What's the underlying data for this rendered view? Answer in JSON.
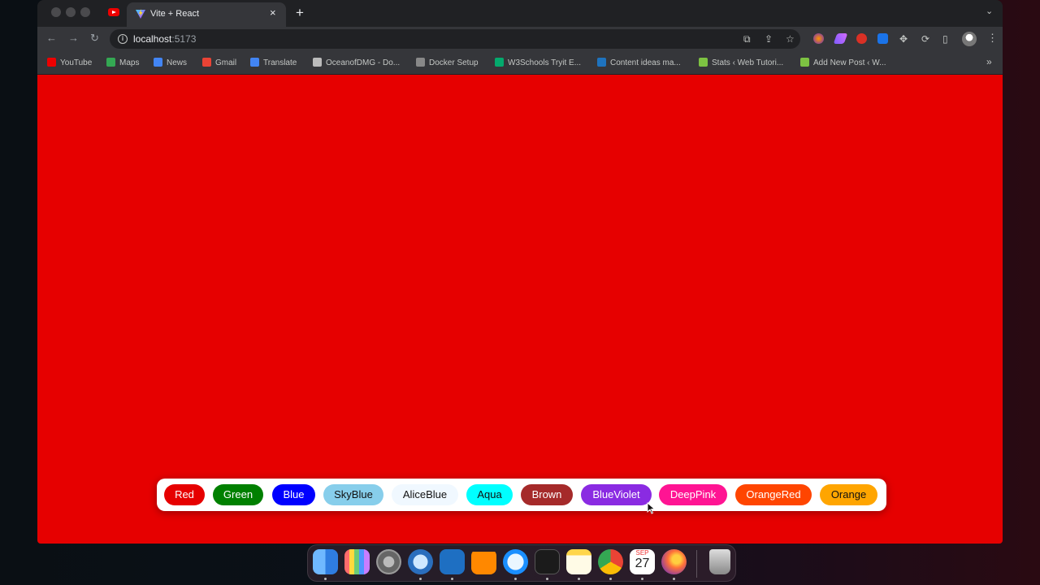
{
  "browser": {
    "tab_title": "Vite + React",
    "url_host": "localhost",
    "url_port": ":5173",
    "new_tab_label": "+",
    "close_label": "×"
  },
  "bookmarks": [
    {
      "label": "YouTube",
      "color": "#e00"
    },
    {
      "label": "Maps",
      "color": "#34a853"
    },
    {
      "label": "News",
      "color": "#4285f4"
    },
    {
      "label": "Gmail",
      "color": "#ea4335"
    },
    {
      "label": "Translate",
      "color": "#4285f4"
    },
    {
      "label": "OceanofDMG - Do...",
      "color": "#bbb"
    },
    {
      "label": "Docker Setup",
      "color": "#888"
    },
    {
      "label": "W3Schools Tryit E...",
      "color": "#04aa6d"
    },
    {
      "label": "Content ideas ma...",
      "color": "#1e73be"
    },
    {
      "label": "Stats ‹ Web Tutori...",
      "color": "#7dc242"
    },
    {
      "label": "Add New Post ‹ W...",
      "color": "#7dc242"
    }
  ],
  "page": {
    "background_color": "#e60000"
  },
  "palette": [
    {
      "label": "Red",
      "bg": "#e60000",
      "fg": "#ffffff"
    },
    {
      "label": "Green",
      "bg": "#008000",
      "fg": "#ffffff"
    },
    {
      "label": "Blue",
      "bg": "#0000ff",
      "fg": "#ffffff"
    },
    {
      "label": "SkyBlue",
      "bg": "#87ceeb",
      "fg": "#111111"
    },
    {
      "label": "AliceBlue",
      "bg": "#f0f8ff",
      "fg": "#111111"
    },
    {
      "label": "Aqua",
      "bg": "#00ffff",
      "fg": "#111111"
    },
    {
      "label": "Brown",
      "bg": "#a52a2a",
      "fg": "#ffffff"
    },
    {
      "label": "BlueViolet",
      "bg": "#8a2be2",
      "fg": "#ffffff"
    },
    {
      "label": "DeepPink",
      "bg": "#ff1493",
      "fg": "#ffffff"
    },
    {
      "label": "OrangeRed",
      "bg": "#ff4500",
      "fg": "#ffffff"
    },
    {
      "label": "Orange",
      "bg": "#ffa500",
      "fg": "#111111"
    }
  ],
  "dock": {
    "calendar_month": "SEP",
    "calendar_day": "27"
  }
}
